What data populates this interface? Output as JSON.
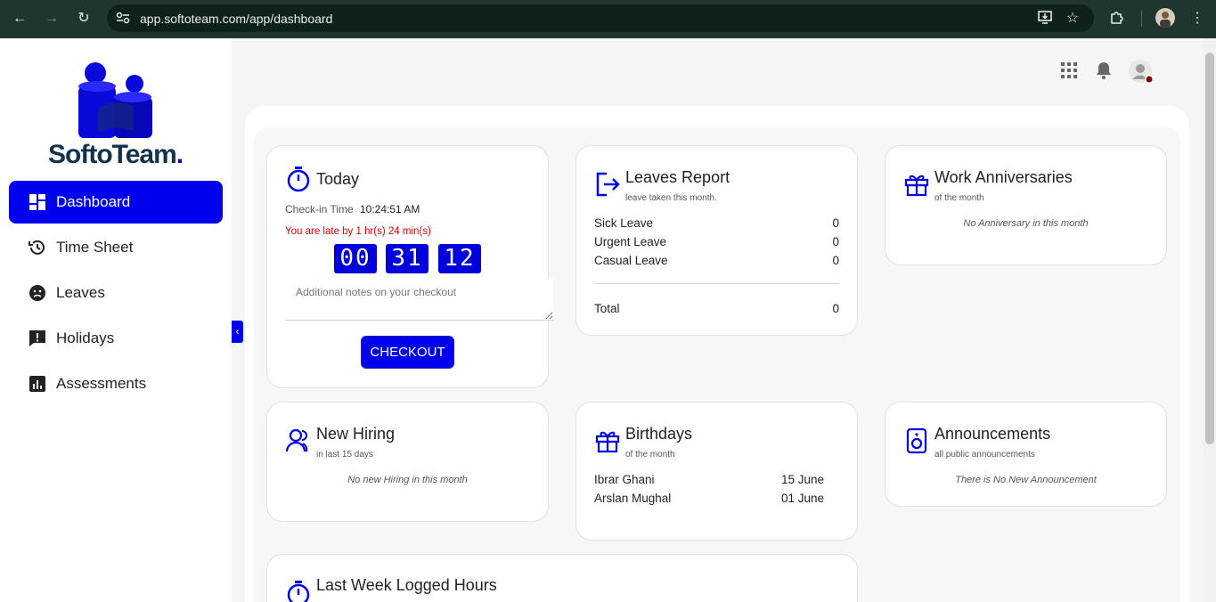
{
  "browser": {
    "url": "app.softoteam.com/app/dashboard"
  },
  "logo": {
    "brand_main": "SoftoTeam",
    "brand_dot": "."
  },
  "sidebar": {
    "items": [
      {
        "label": "Dashboard",
        "icon": "dashboard-icon",
        "active": true
      },
      {
        "label": "Time Sheet",
        "icon": "history-icon",
        "active": false
      },
      {
        "label": "Leaves",
        "icon": "leaves-icon",
        "active": false
      },
      {
        "label": "Holidays",
        "icon": "alert-message-icon",
        "active": false
      },
      {
        "label": "Assessments",
        "icon": "assessment-icon",
        "active": false
      }
    ]
  },
  "today": {
    "title": "Today",
    "checkin_label": "Check-in Time",
    "checkin_time": "10:24:51 AM",
    "late_text": "You are late by 1 hr(s) 24 min(s)",
    "timer_h": "00",
    "timer_m": "31",
    "timer_s": "12",
    "notes_placeholder": "Additional notes on your checkout",
    "checkout_label": "CHECKOUT"
  },
  "leaves_report": {
    "title": "Leaves Report",
    "subtitle": "leave taken this month.",
    "rows": [
      {
        "label": "Sick Leave",
        "value": "0"
      },
      {
        "label": "Urgent Leave",
        "value": "0"
      },
      {
        "label": "Casual Leave",
        "value": "0"
      }
    ],
    "total_label": "Total",
    "total_value": "0"
  },
  "anniversaries": {
    "title": "Work Anniversaries",
    "subtitle": "of the month",
    "empty": "No Anniversary in this month"
  },
  "new_hiring": {
    "title": "New Hiring",
    "subtitle": "in last 15 days",
    "empty": "No new Hiring in this month"
  },
  "birthdays": {
    "title": "Birthdays",
    "subtitle": "of the month",
    "rows": [
      {
        "name": "Ibrar Ghani",
        "date": "15 June"
      },
      {
        "name": "Arslan Mughal",
        "date": "01 June"
      }
    ]
  },
  "announcements": {
    "title": "Announcements",
    "subtitle": "all public announcements",
    "empty": "There is No New Announcement"
  },
  "logged_hours": {
    "title": "Last Week Logged Hours"
  },
  "colors": {
    "accent": "#0000ee",
    "late": "#e00000",
    "chrome": "#1f3530"
  }
}
